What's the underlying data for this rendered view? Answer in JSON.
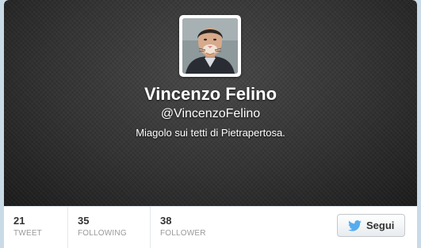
{
  "profile": {
    "name": "Vincenzo Felino",
    "handle": "@VincenzoFelino",
    "bio": "Miagolo sui tetti di Pietrapertosa.",
    "avatar_icon": "profile-photo"
  },
  "stats": [
    {
      "value": "21",
      "label": "TWEET"
    },
    {
      "value": "35",
      "label": "FOLLOWING"
    },
    {
      "value": "38",
      "label": "FOLLOWER"
    }
  ],
  "follow_button": {
    "label": "Segui",
    "icon": "twitter-bird-icon"
  },
  "colors": {
    "banner": "#2e2e2e",
    "bird": "#55acee",
    "stat_label": "#999999"
  }
}
